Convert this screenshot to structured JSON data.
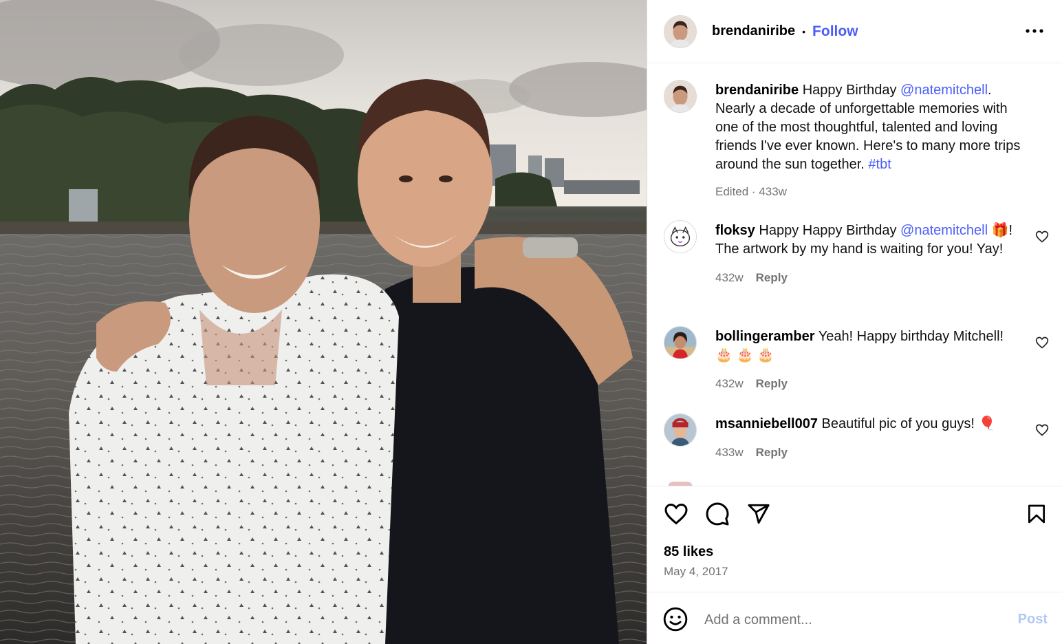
{
  "header": {
    "username": "brendaniribe",
    "separator": "•",
    "follow_label": "Follow",
    "more_icon": "more-horizontal-icon"
  },
  "caption": {
    "username": "brendaniribe",
    "text_before": "Happy Birthday",
    "mention": "@natemitchell",
    "text_after": ". Nearly a decade of unforgettable memories with one of the most thoughtful, talented and loving friends I've ever known. Here's to many more trips around the sun together.",
    "hashtag": "#tbt",
    "meta": "Edited · 433w"
  },
  "comments": [
    {
      "username": "floksy",
      "text_before": "Happy Happy Birthday",
      "mention": "@natemitchell",
      "text_after": "🎁! The artwork by my hand is waiting for you! Yay!",
      "time": "432w",
      "reply_label": "Reply"
    },
    {
      "username": "bollingeramber",
      "text_before": "Yeah! Happy birthday Mitchell!",
      "text_after": "🎂 🎂 🎂",
      "time": "432w",
      "reply_label": "Reply"
    },
    {
      "username": "msanniebell007",
      "text_before": "Beautiful pic of you guys! 🎈",
      "time": "433w",
      "reply_label": "Reply"
    }
  ],
  "actions": {
    "like_icon": "heart-icon",
    "comment_icon": "comment-icon",
    "share_icon": "share-icon",
    "save_icon": "bookmark-icon",
    "likes": "85 likes",
    "date": "May 4, 2017"
  },
  "add_comment": {
    "emoji_icon": "emoji-icon",
    "placeholder": "Add a comment...",
    "post_label": "Post"
  },
  "colors": {
    "link": "#4a5df9",
    "muted": "#737373",
    "post_disabled": "#b3c8f7"
  }
}
